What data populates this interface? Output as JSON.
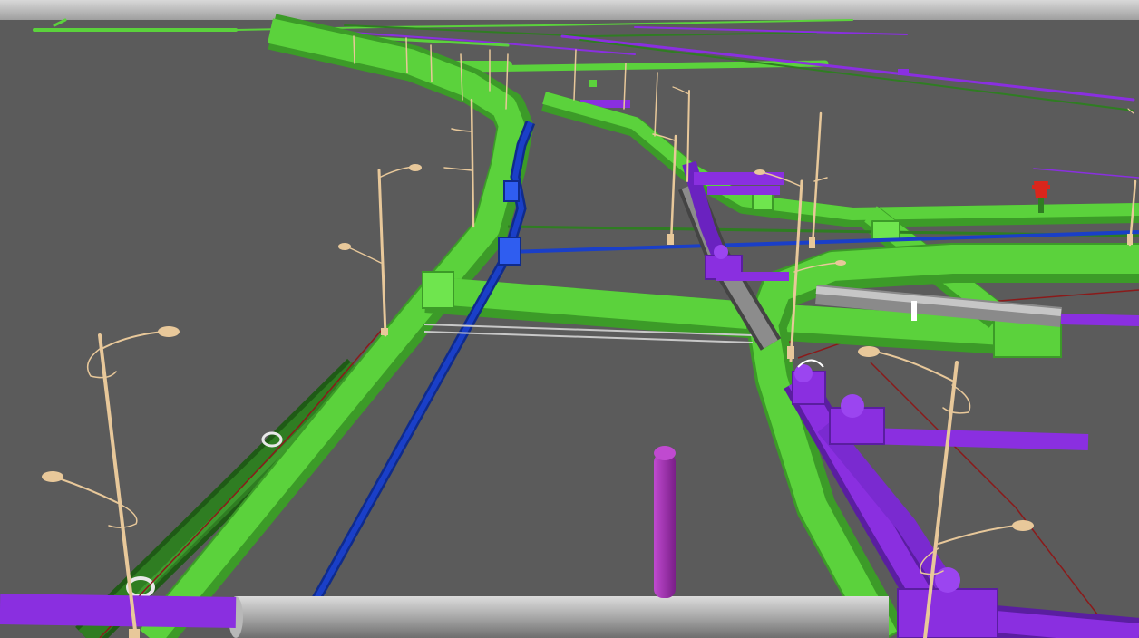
{
  "viewport": {
    "sky_color": "#d2d2d2",
    "ground_color": "#5b5b5b"
  },
  "layers": [
    {
      "name": "green-duct",
      "color": "#5bd23c"
    },
    {
      "name": "dark-green-pipe",
      "color": "#2f7d22"
    },
    {
      "name": "purple-pipe",
      "color": "#8a2fe0"
    },
    {
      "name": "blue-pipe",
      "color": "#1a3fc8"
    },
    {
      "name": "gray-pipe",
      "color": "#a9a9a9"
    },
    {
      "name": "magenta-pipe",
      "color": "#9b2aa8"
    },
    {
      "name": "red-cable",
      "color": "#8b1a1a"
    },
    {
      "name": "street-lamp",
      "color": "#e8c89a"
    },
    {
      "name": "hydrant",
      "color": "#d9261c"
    }
  ]
}
